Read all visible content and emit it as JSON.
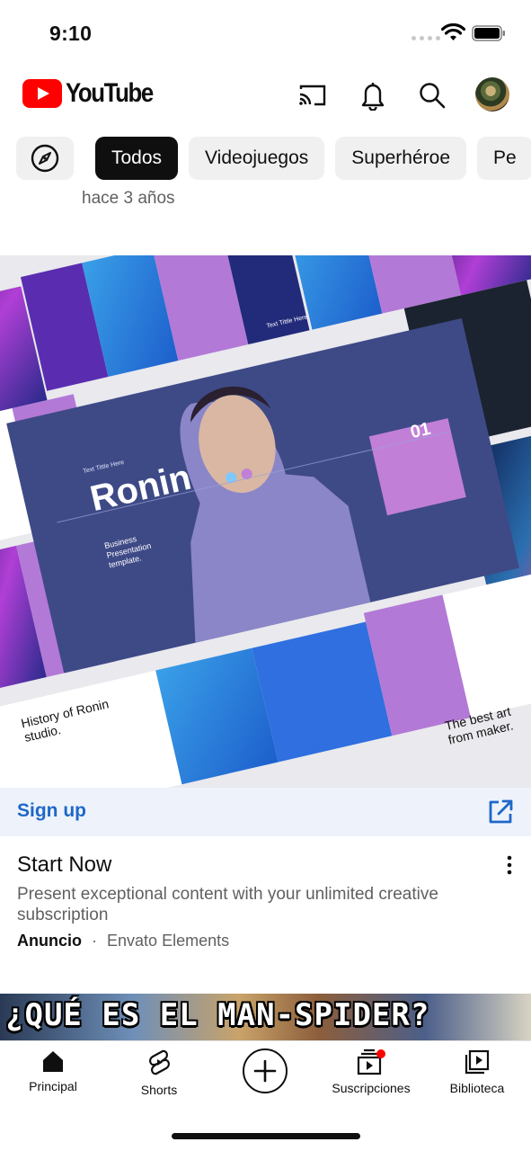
{
  "status_bar": {
    "time": "9:10"
  },
  "header": {
    "logo_text": "YouTube",
    "brand_color": "#ff0000",
    "icons": [
      "cast-icon",
      "bell-icon",
      "search-icon"
    ]
  },
  "chips": {
    "explore_icon": "compass-icon",
    "items": [
      "Todos",
      "Videojuegos",
      "Superhéroe",
      "Pe"
    ],
    "active": "Todos"
  },
  "previous_item": {
    "meta": "hace 3 años"
  },
  "ad": {
    "thumbnail": {
      "main_slide_title": "Ronin",
      "main_slide_small": "Text Tittle Here",
      "main_slide_number": "01",
      "main_slide_desc": "Business Presentation template.",
      "slide_history": "History of Ronin studio.",
      "slide_bestart": "The best art from maker.",
      "slide_tittle": "Text Tittle Here"
    },
    "cta_label": "Sign up",
    "title": "Start Now",
    "description": "Present exceptional content with your unlimited creative subscription",
    "badge": "Anuncio",
    "separator": "·",
    "advertiser": "Envato Elements"
  },
  "next_video": {
    "title": "¿QUÉ ES EL MAN-SPIDER?"
  },
  "bottom_nav": {
    "home": "Principal",
    "shorts": "Shorts",
    "subscriptions": "Suscripciones",
    "library": "Biblioteca"
  },
  "colors": {
    "link_blue": "#1f67c9",
    "notification_dot": "#ff0000",
    "chip_active_bg": "#0f0f0f"
  }
}
